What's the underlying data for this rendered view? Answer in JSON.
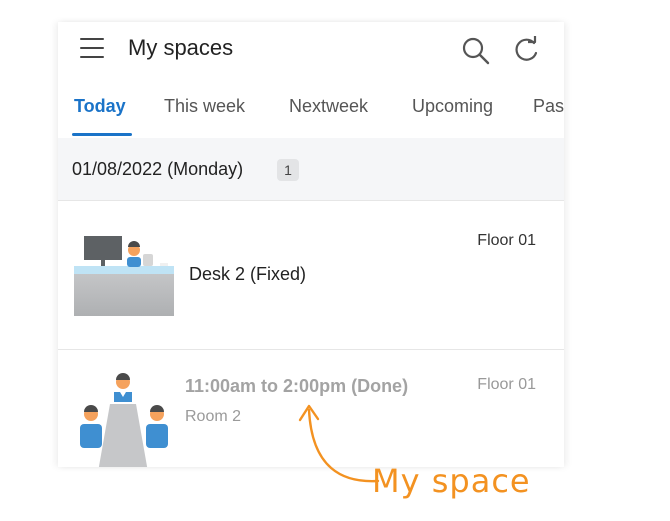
{
  "app_bar": {
    "title": "My spaces",
    "icons": [
      "menu-icon",
      "search-icon",
      "refresh-icon"
    ]
  },
  "tabs": [
    {
      "label": "Today",
      "active": true
    },
    {
      "label": "This week",
      "active": false
    },
    {
      "label": "Nextweek",
      "active": false
    },
    {
      "label": "Upcoming",
      "active": false
    },
    {
      "label": "Pas",
      "active": false
    }
  ],
  "date_group": {
    "date": "01/08/2022 (Monday)",
    "count": "1"
  },
  "bookings": [
    {
      "title": "Desk 2  (Fixed)",
      "floor": "Floor 01",
      "icon": "desk-illustration"
    },
    {
      "title": "11:00am to 2:00pm (Done)",
      "subtitle": "Room 2",
      "floor": "Floor 01",
      "icon": "meeting-room-illustration"
    }
  ],
  "annotation": {
    "text": "My space"
  },
  "colors": {
    "accent": "#1a73c8",
    "annotation": "#f39221",
    "header_bg": "#f5f6f8"
  }
}
